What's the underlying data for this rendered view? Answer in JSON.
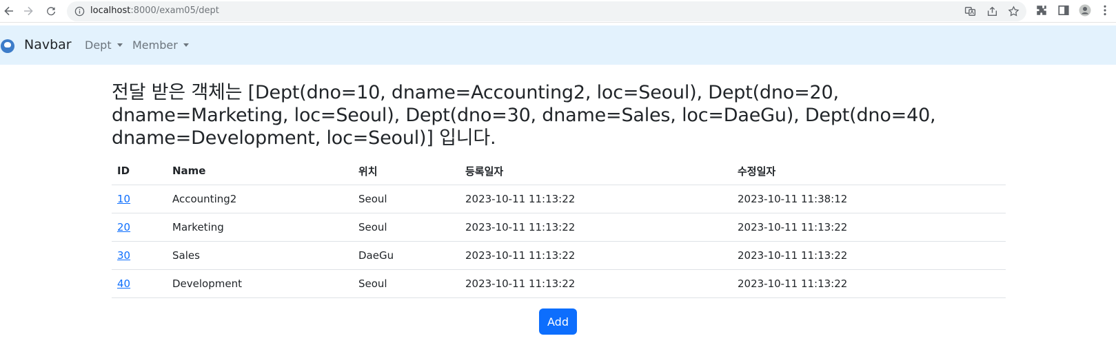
{
  "browser": {
    "url_host": "localhost",
    "url_path": ":8000/exam05/dept"
  },
  "navbar": {
    "brand": "Navbar",
    "items": [
      {
        "label": "Dept"
      },
      {
        "label": "Member"
      }
    ]
  },
  "main": {
    "heading": "전달 받은 객체는 [Dept(dno=10, dname=Accounting2, loc=Seoul), Dept(dno=20, dname=Marketing, loc=Seoul), Dept(dno=30, dname=Sales, loc=DaeGu), Dept(dno=40, dname=Development, loc=Seoul)] 입니다.",
    "table": {
      "headers": [
        "ID",
        "Name",
        "위치",
        "등록일자",
        "수정일자"
      ],
      "rows": [
        {
          "id": "10",
          "name": "Accounting2",
          "loc": "Seoul",
          "created": "2023-10-11 11:13:22",
          "updated": "2023-10-11 11:38:12"
        },
        {
          "id": "20",
          "name": "Marketing",
          "loc": "Seoul",
          "created": "2023-10-11 11:13:22",
          "updated": "2023-10-11 11:13:22"
        },
        {
          "id": "30",
          "name": "Sales",
          "loc": "DaeGu",
          "created": "2023-10-11 11:13:22",
          "updated": "2023-10-11 11:13:22"
        },
        {
          "id": "40",
          "name": "Development",
          "loc": "Seoul",
          "created": "2023-10-11 11:13:22",
          "updated": "2023-10-11 11:13:22"
        }
      ]
    },
    "add_label": "Add"
  },
  "colors": {
    "navbar_bg": "#e3f2fd",
    "primary": "#0d6efd",
    "link": "#0d6efd"
  }
}
